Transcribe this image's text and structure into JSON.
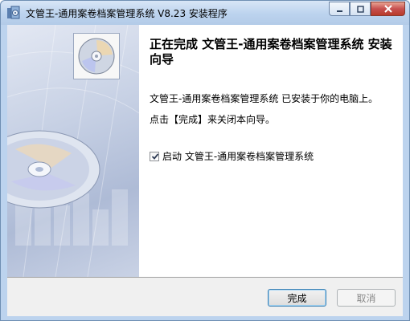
{
  "window": {
    "title": "文管王-通用案卷档案管理系统 V8.23 安装程序",
    "minimize_icon": "minimize-icon",
    "maximize_icon": "maximize-icon",
    "close_icon": "close-icon"
  },
  "content": {
    "heading": "正在完成 文管王-通用案卷档案管理系统 安装向导",
    "line1": "文管王-通用案卷档案管理系统 已安装于你的电脑上。",
    "line2": "点击【完成】来关闭本向导。",
    "launch_checkbox": {
      "label": "启动 文管王-通用案卷档案管理系统",
      "checked": true
    }
  },
  "footer": {
    "finish_label": "完成",
    "cancel_label": "取消",
    "cancel_enabled": false
  },
  "colors": {
    "accent": "#3c7fb1",
    "close": "#c75050",
    "panel": "#aebbd6"
  }
}
